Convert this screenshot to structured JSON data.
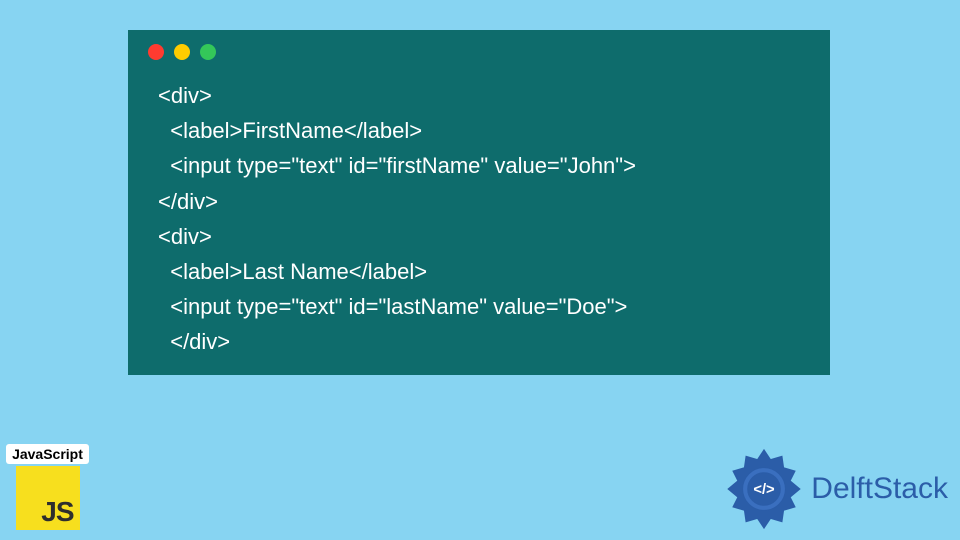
{
  "code_window": {
    "lines": [
      "<div>",
      "  <label>FirstName</label>",
      "  <input type=\"text\" id=\"firstName\" value=\"John\">",
      "</div>",
      "<div>",
      "  <label>Last Name</label>",
      "  <input type=\"text\" id=\"lastName\" value=\"Doe\">",
      "  </div>"
    ]
  },
  "js_logo": {
    "label": "JavaScript",
    "badge_text": "JS"
  },
  "delft_logo": {
    "text": "DelftStack"
  }
}
